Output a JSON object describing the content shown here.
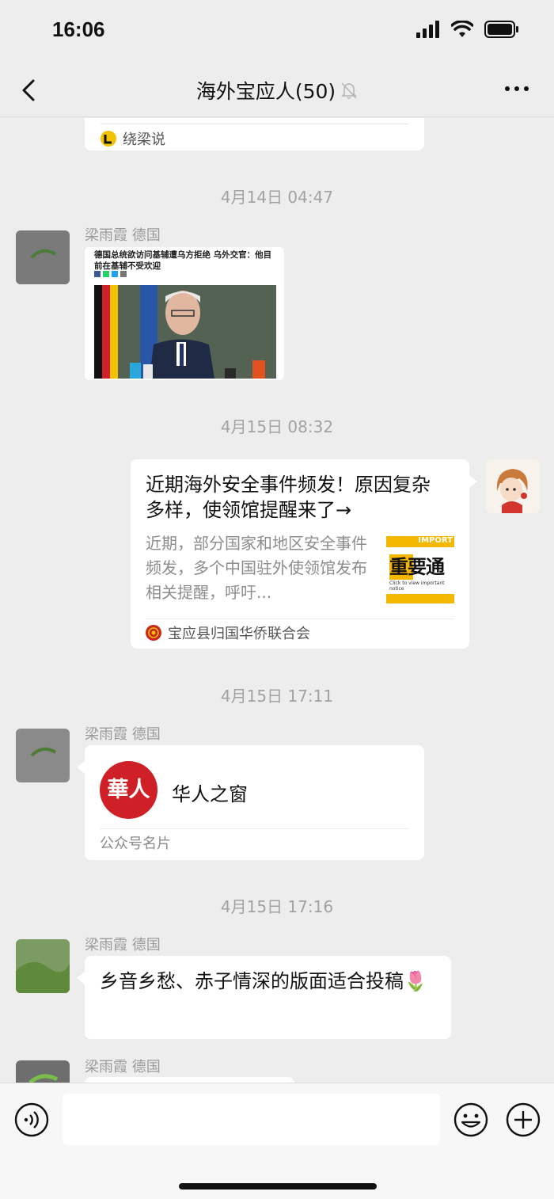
{
  "status_bar": {
    "time": "16:06"
  },
  "header": {
    "title": "海外宝应人(50)"
  },
  "messages": {
    "prev_card": {
      "source": "绕梁说"
    },
    "ts1": "4月14日 04:47",
    "image_msg": {
      "sender": "梁雨霞 德国",
      "headline": "德国总统欲访问基辅遭乌方拒绝 乌外交官：他目前在基辅不受欢迎"
    },
    "ts2": "4月15日 08:32",
    "article": {
      "title": "近期海外安全事件频发！原因复杂多样，使领馆提醒来了→",
      "desc": "近期，部分国家和地区安全事件频发，多个中国驻外使领馆发布相关提醒，呼吁...",
      "thumb_top": "IMPORT",
      "thumb_big": "重要通",
      "thumb_note": "Click to view important notice",
      "source": "宝应县归国华侨联合会"
    },
    "ts3": "4月15日 17:11",
    "biz_card": {
      "sender": "梁雨霞 德国",
      "logo_text": "華人",
      "name": "华人之窗",
      "kind": "公众号名片"
    },
    "ts4": "4月15日 17:16",
    "text_msg": {
      "sender": "梁雨霞 德国",
      "text": "乡音乡愁、赤子情深的版面适合投稿🌷"
    },
    "next_msg": {
      "sender": "梁雨霞 德国"
    }
  },
  "input": {
    "placeholder": ""
  }
}
